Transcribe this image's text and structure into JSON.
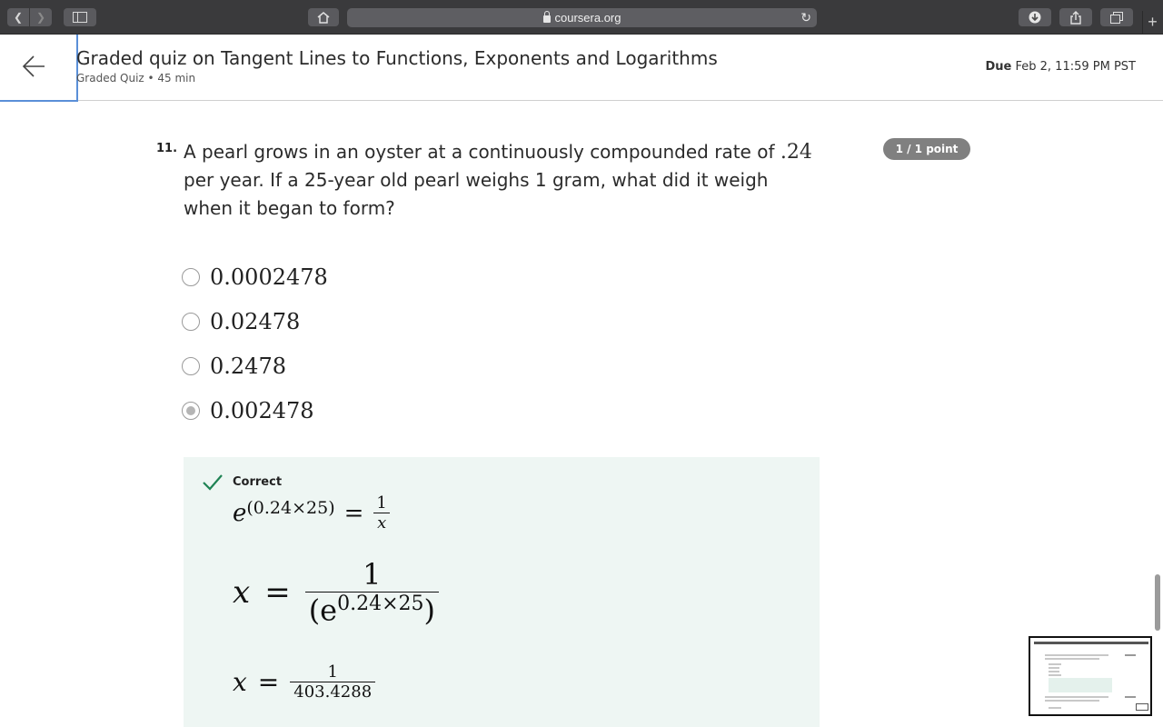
{
  "browser": {
    "url": "coursera.org",
    "back_icon": "chevron-left",
    "forward_icon": "chevron-right"
  },
  "header": {
    "title": "Graded quiz on Tangent Lines to Functions, Exponents and Logarithms",
    "subtitle": "Graded Quiz • 45 min",
    "due_label": "Due",
    "due_value": "Feb 2, 11:59 PM PST"
  },
  "question": {
    "number": "11.",
    "text_part1": "A pearl grows in an oyster at a continuously compounded rate of",
    "rate": ".24",
    "text_part2": "per year. If a 25-year old pearl weighs 1 gram, what did it weigh when it began to form?",
    "points": "1 / 1 point",
    "options": [
      "0.0002478",
      "0.02478",
      "0.2478",
      "0.002478"
    ],
    "selected_index": 3
  },
  "feedback": {
    "status": "Correct",
    "eq1": {
      "base": "e",
      "exp": "(0.24×25)",
      "equals": "=",
      "num": "1",
      "den": "x"
    },
    "eq2": {
      "lhs": "x",
      "equals": "=",
      "num": "1",
      "den_open": "(e",
      "den_exp": "0.24×25",
      "den_close": ")"
    },
    "eq3": {
      "lhs": "x",
      "equals": "=",
      "num": "1",
      "den": "403.4288"
    }
  },
  "colors": {
    "toolbar": "#3a3a3c",
    "accent_focus": "#5a8fd8",
    "feedback_bg": "#eef6f3",
    "check_green": "#1f8354",
    "points_badge": "#808080"
  }
}
